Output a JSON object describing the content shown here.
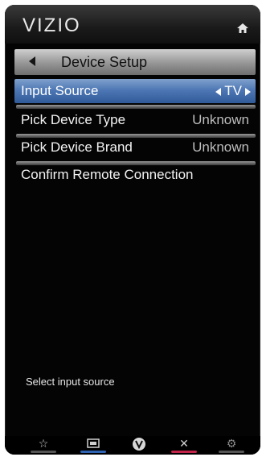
{
  "header": {
    "brand": "VIZIO",
    "home_icon": "home-icon"
  },
  "breadcrumb": {
    "label": "Device Setup",
    "icon": "back-icon"
  },
  "menu": {
    "items": [
      {
        "label": "Input Source",
        "value": "TV",
        "selected": true
      },
      {
        "label": "Pick Device Type",
        "value": "Unknown",
        "selected": false
      },
      {
        "label": "Pick Device Brand",
        "value": "Unknown",
        "selected": false
      },
      {
        "label": "Confirm Remote Connection",
        "value": "",
        "selected": false
      }
    ]
  },
  "help_text": "Select input source",
  "bottom_bar": {
    "buttons": [
      {
        "icon": "star-icon",
        "color": "#666666"
      },
      {
        "icon": "screen-icon",
        "color": "#2f63b3"
      },
      {
        "icon": "v-button-icon",
        "color": "#1a1a1a"
      },
      {
        "icon": "close-icon",
        "color": "#c4244a"
      },
      {
        "icon": "gear-icon",
        "color": "#666666"
      }
    ]
  },
  "colors": {
    "selection": "#4e78b5",
    "background": "#040404"
  }
}
